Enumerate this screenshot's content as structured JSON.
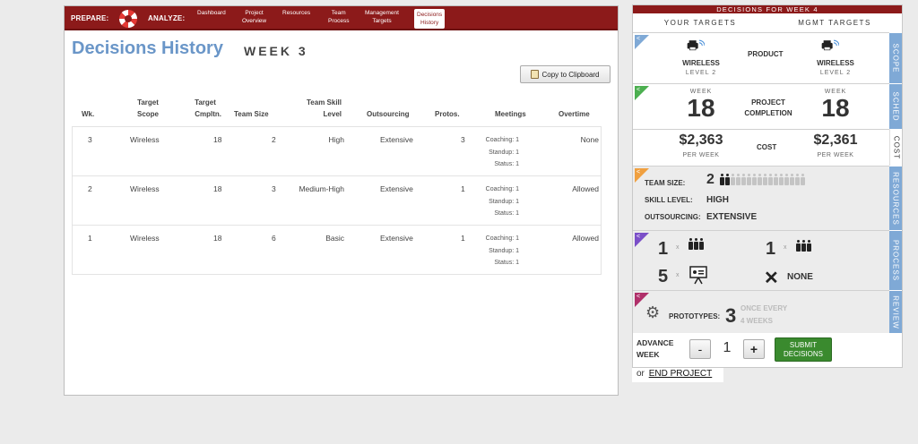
{
  "nav": {
    "prepare_label": "PREPARE:",
    "analyze_label": "ANALYZE:",
    "tabs": [
      {
        "line1": "Dashboard",
        "line2": ""
      },
      {
        "line1": "Project",
        "line2": "Overview"
      },
      {
        "line1": "Resources",
        "line2": ""
      },
      {
        "line1": "Team",
        "line2": "Process"
      },
      {
        "line1": "Management",
        "line2": "Targets"
      },
      {
        "line1": "Decisions",
        "line2": "History"
      }
    ],
    "active_tab": "Decisions History"
  },
  "page": {
    "title": "Decisions History",
    "week_label": "WEEK 3",
    "copy_button": "Copy to Clipboard"
  },
  "table": {
    "headers": {
      "wk": "Wk.",
      "target_scope": [
        "Target",
        "Scope"
      ],
      "target_cmpltn": [
        "Target",
        "Cmpltn."
      ],
      "team_size": "Team Size",
      "team_skill": [
        "Team Skill",
        "Level"
      ],
      "outsourcing": "Outsourcing",
      "protos": "Protos.",
      "meetings": "Meetings",
      "overtime": "Overtime"
    },
    "rows": [
      {
        "wk": "3",
        "scope": "Wireless",
        "cmpltn": "18",
        "size": "2",
        "skill": "High",
        "outsourcing": "Extensive",
        "protos": "3",
        "coaching": "Coaching: 1",
        "standup": "Standup: 1",
        "status": "Status: 1",
        "overtime": "None"
      },
      {
        "wk": "2",
        "scope": "Wireless",
        "cmpltn": "18",
        "size": "3",
        "skill": "Medium-High",
        "outsourcing": "Extensive",
        "protos": "1",
        "coaching": "Coaching: 1",
        "standup": "Standup: 1",
        "status": "Status: 1",
        "overtime": "Allowed"
      },
      {
        "wk": "1",
        "scope": "Wireless",
        "cmpltn": "18",
        "size": "6",
        "skill": "Basic",
        "outsourcing": "Extensive",
        "protos": "1",
        "coaching": "Coaching: 1",
        "standup": "Standup: 1",
        "status": "Status: 1",
        "overtime": "Allowed"
      }
    ]
  },
  "decisions": {
    "header": "DECISIONS FOR WEEK 4",
    "col_yours": "YOUR TARGETS",
    "col_mgmt": "MGMT TARGETS",
    "scope": {
      "side": "SCOPE",
      "center": "PRODUCT",
      "yours_name": "WIRELESS",
      "yours_level": "LEVEL 2",
      "mgmt_name": "WIRELESS",
      "mgmt_level": "LEVEL 2"
    },
    "sched": {
      "side": "SCHED",
      "center1": "PROJECT",
      "center2": "COMPLETION",
      "week_word": "WEEK",
      "yours": "18",
      "mgmt": "18"
    },
    "cost": {
      "side": "COST",
      "center": "COST",
      "yours": "$2,363",
      "mgmt": "$2,361",
      "per_week": "PER WEEK"
    },
    "resources": {
      "side": "RESOURCES",
      "team_size_label": "TEAM SIZE:",
      "team_size": "2",
      "team_capacity": 16,
      "skill_label": "SKILL LEVEL:",
      "skill": "HIGH",
      "outsourcing_label": "OUTSOURCING:",
      "outsourcing": "EXTENSIVE"
    },
    "process": {
      "side": "PROCESS",
      "coaching": "1",
      "standup": "1",
      "status": "5",
      "overtime": "NONE",
      "times": "x"
    },
    "review": {
      "side": "REVIEW",
      "prototypes_label": "PROTOTYPES:",
      "prototypes": "3",
      "once_every": "ONCE EVERY",
      "weeks": "4 WEEKS"
    },
    "advance": {
      "label1": "ADVANCE",
      "label2": "WEEK",
      "minus": "-",
      "value": "1",
      "plus": "+",
      "submit1": "SUBMIT",
      "submit2": "DECISIONS",
      "or": "or",
      "end": "END PROJECT"
    },
    "colors": {
      "brand_red": "#8c1a1a",
      "side_blue": "#7fa9d6",
      "tag_scope": "#7fa9d6",
      "tag_sched": "#4caf50",
      "tag_resources": "#f0a040",
      "tag_process": "#7b4fc8",
      "tag_review": "#b0306a",
      "submit_green": "#3a8a2e"
    }
  }
}
